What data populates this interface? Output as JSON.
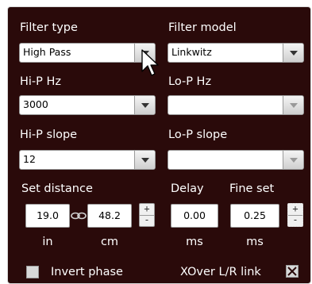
{
  "filter_type": {
    "label": "Filter type",
    "value": "High Pass"
  },
  "filter_model": {
    "label": "Filter model",
    "value": "Linkwitz"
  },
  "hip_hz": {
    "label": "Hi-P Hz",
    "value": "3000"
  },
  "lop_hz": {
    "label": "Lo-P Hz",
    "value": ""
  },
  "hip_slope": {
    "label": "Hi-P slope",
    "value": "12"
  },
  "lop_slope": {
    "label": "Lo-P slope",
    "value": ""
  },
  "set_distance": {
    "label": "Set distance",
    "in_value": "19.0",
    "cm_value": "48.2",
    "in_unit": "in",
    "cm_unit": "cm",
    "spin_up": "+",
    "spin_down": "-"
  },
  "delay": {
    "label": "Delay",
    "value": "0.00",
    "unit": "ms"
  },
  "fine_set": {
    "label": "Fine set",
    "value": "0.25",
    "unit": "ms",
    "spin_up": "+",
    "spin_down": "-"
  },
  "invert_phase": {
    "label": "Invert phase",
    "checked": false
  },
  "xover_link": {
    "label": "XOver L/R link",
    "checked": true
  },
  "icons": {
    "link": "chain-link-icon",
    "dropdown": "chevron-down-icon",
    "cursor": "mouse-pointer-icon"
  },
  "colors": {
    "panel_bg": "#2a0a0a",
    "text": "#ffffff",
    "field_bg": "#ffffff"
  }
}
